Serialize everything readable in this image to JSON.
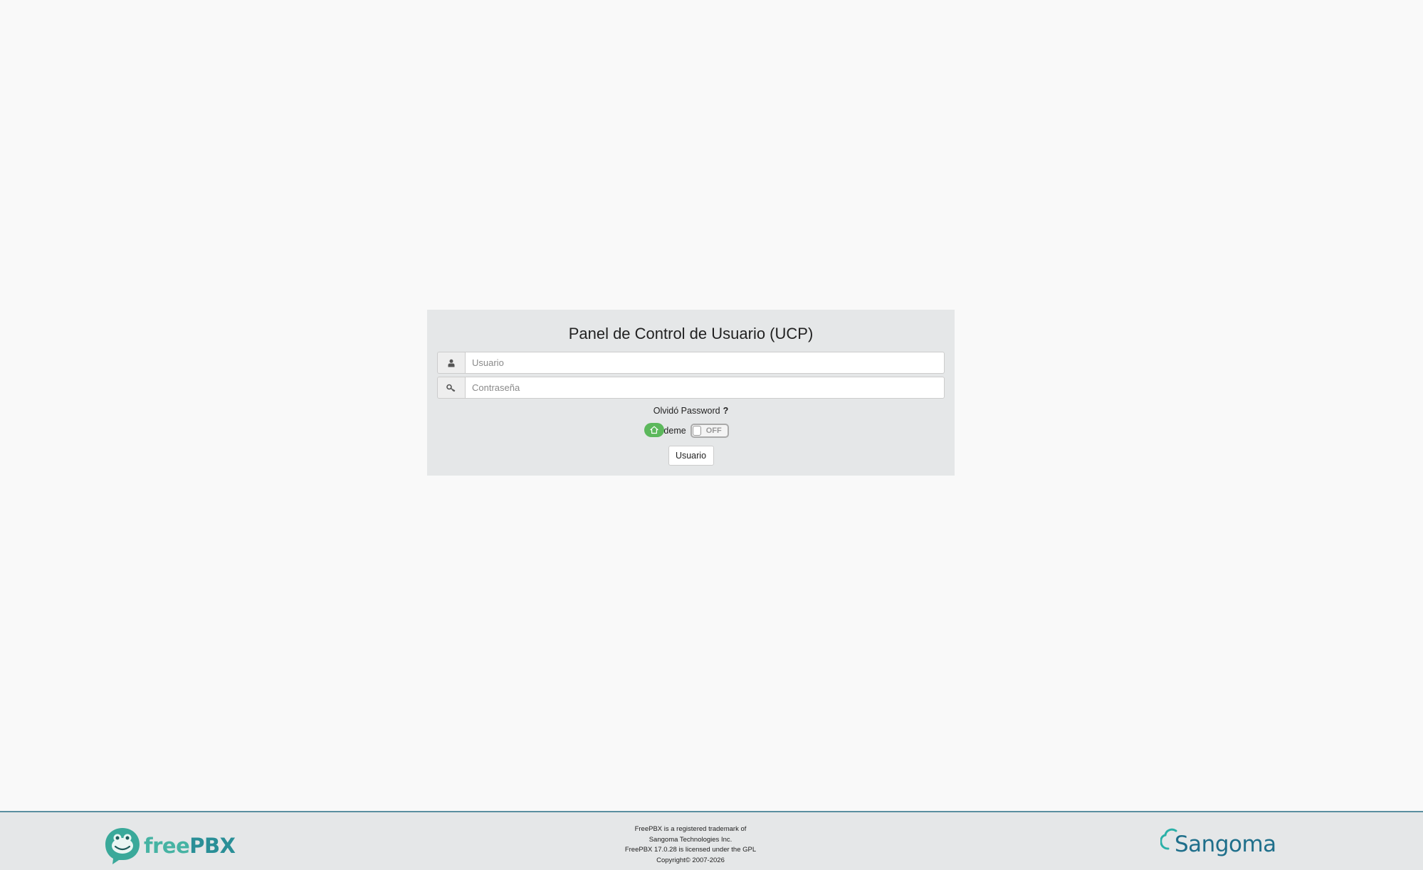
{
  "login": {
    "title": "Panel de Control de Usuario (UCP)",
    "username_placeholder": "Usuario",
    "username_icon": "user-icon",
    "password_placeholder": "Contraseña",
    "password_icon": "key-icon",
    "forgot_label": "Olvidó Password",
    "forgot_mark": "?",
    "remember_label": "erdeme",
    "remember_toggle_state": "OFF",
    "submit_label": "Usuario"
  },
  "footer": {
    "logo_left_free": "free",
    "logo_left_pbx": "PBX",
    "lines": [
      "FreePBX is a registered trademark of",
      "Sangoma Technologies Inc.",
      "FreePBX 17.0.28 is licensed under the GPL",
      "Copyright© 2007-2026"
    ],
    "logo_right": "Sangoma"
  },
  "colors": {
    "panel_bg": "#e5e7e8",
    "page_bg": "#f9f9f9",
    "badge_green": "#5cb85c",
    "freepbx_teal": "#46b3a3",
    "sangoma_blue": "#1f6f8b"
  }
}
